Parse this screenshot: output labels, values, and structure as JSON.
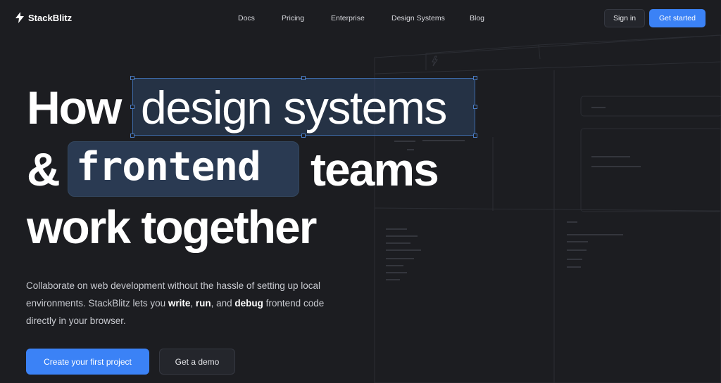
{
  "brand": {
    "name": "StackBlitz",
    "icon": "lightning-bolt-icon"
  },
  "nav": {
    "links": [
      "Docs",
      "Pricing",
      "Enterprise",
      "Design Systems",
      "Blog"
    ],
    "sign_in": "Sign in",
    "get_started": "Get started"
  },
  "hero": {
    "line1_prefix": "How",
    "line1_highlight": "design systems",
    "line2_amp": "&",
    "line2_code": "frontend",
    "line2_suffix": "teams",
    "line3": "work together",
    "sub_part1": "Collaborate on web development without the hassle of setting up local environments. StackBlitz lets you ",
    "sub_write": "write",
    "sub_sep1": ", ",
    "sub_run": "run",
    "sub_sep2": ", and ",
    "sub_debug": "debug",
    "sub_part2": " frontend code directly in your browser.",
    "primary_cta": "Create your first project",
    "secondary_cta": "Get a demo"
  },
  "colors": {
    "background": "#1c1d21",
    "accent": "#3b82f6",
    "highlight": "#2a3a52"
  }
}
